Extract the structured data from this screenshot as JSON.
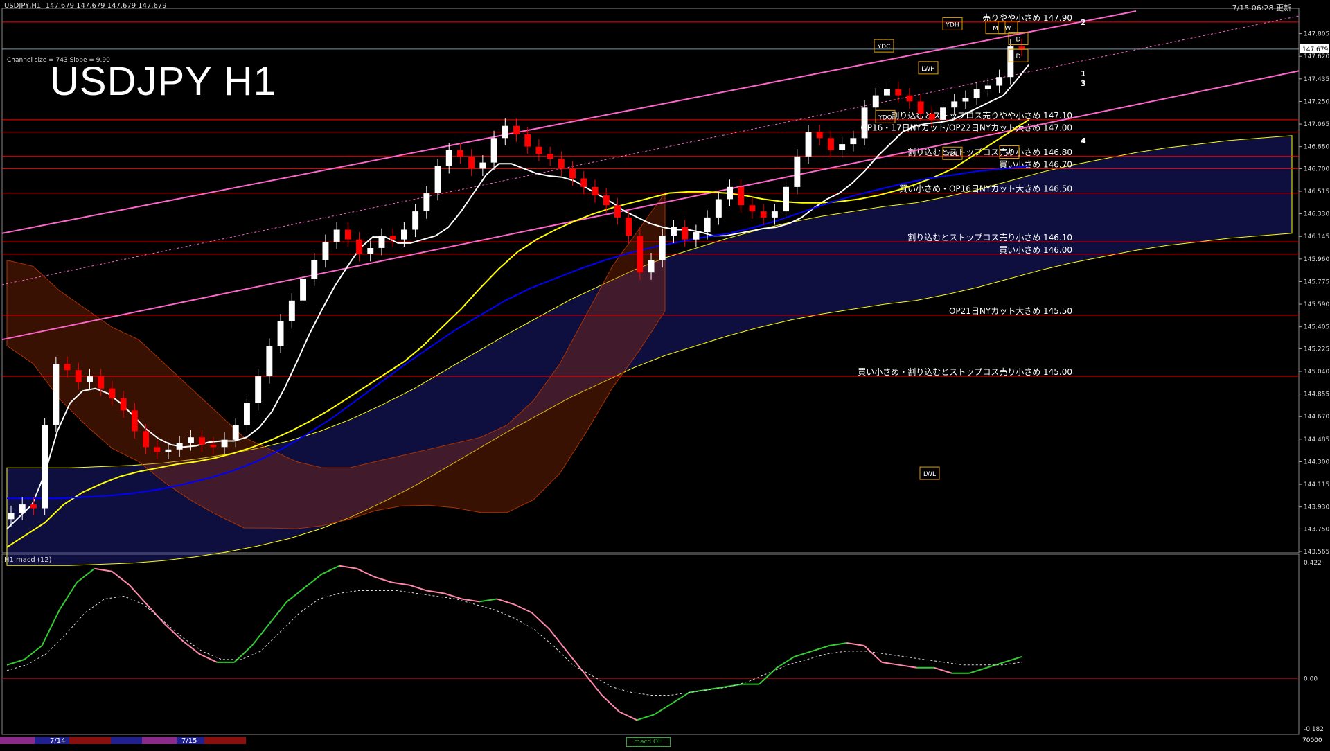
{
  "header": {
    "symbol_info": "USDJPY,H1  147.679 147.679 147.679 147.679",
    "timestamp": "7/15 06:28 更新",
    "big_title": "USDJPY H1",
    "channel_info": "Channel size = 743 Slope = 9.90"
  },
  "sub_window": {
    "title": "H1  macd (12)"
  },
  "time_axis": {
    "labels": [
      "7/14",
      "7/15"
    ],
    "macd_tag": "macd OH",
    "right_value": "70000"
  },
  "colors": {
    "background": "#000000",
    "bull": "#ffffff",
    "bear": "#ff0000",
    "ema_fast": "#ffffff",
    "ema_mid": "#ffff00",
    "ema_slow": "#0000ff",
    "channel": "#ff66cc",
    "level_line": "#ff0000",
    "cloud_bull": "#5555ff",
    "cloud_bear": "#ff5500",
    "macd_up": "#33cc33",
    "macd_down": "#ff88aa"
  },
  "chart_data": {
    "type": "line",
    "title": "USDJPY H1",
    "price_axis": {
      "ylim": [
        143.565,
        147.99
      ],
      "ticks": [
        "147.805",
        "147.620",
        "147.435",
        "147.250",
        "147.065",
        "146.880",
        "146.700",
        "146.515",
        "146.330",
        "146.145",
        "145.960",
        "145.775",
        "145.590",
        "145.405",
        "145.225",
        "145.040",
        "144.855",
        "144.670",
        "144.485",
        "144.300",
        "144.115",
        "143.930",
        "143.750",
        "143.565"
      ],
      "current_price": "147.679"
    },
    "macd_axis": {
      "ylim": [
        -0.182,
        0.422
      ],
      "ticks": [
        "0.422",
        "0.00",
        "-0.182"
      ]
    },
    "price_series": {
      "name": "USDJPY",
      "close": [
        143.88,
        143.95,
        143.92,
        144.6,
        145.1,
        145.05,
        144.95,
        145.0,
        144.9,
        144.82,
        144.72,
        144.55,
        144.42,
        144.38,
        144.4,
        144.45,
        144.5,
        144.44,
        144.42,
        144.48,
        144.6,
        144.78,
        145.0,
        145.25,
        145.45,
        145.62,
        145.8,
        145.95,
        146.1,
        146.2,
        146.12,
        146.0,
        146.05,
        146.15,
        146.12,
        146.2,
        146.35,
        146.5,
        146.72,
        146.85,
        146.8,
        146.7,
        146.75,
        146.95,
        147.05,
        146.98,
        146.88,
        146.82,
        146.78,
        146.7,
        146.62,
        146.55,
        146.48,
        146.4,
        146.3,
        146.15,
        145.85,
        145.95,
        146.15,
        146.22,
        146.12,
        146.18,
        146.3,
        146.45,
        146.55,
        146.4,
        146.35,
        146.3,
        146.35,
        146.55,
        146.8,
        147.0,
        146.95,
        146.85,
        146.9,
        146.95,
        147.2,
        147.3,
        147.35,
        147.3,
        147.25,
        147.15,
        147.1,
        147.2,
        147.25,
        147.28,
        147.35,
        147.38,
        147.45,
        147.7,
        147.68
      ]
    },
    "moving_averages": [
      {
        "name": "",
        "color": "#ffffff",
        "values": [
          143.75,
          143.85,
          143.95,
          144.2,
          144.55,
          144.78,
          144.88,
          144.9,
          144.86,
          144.78,
          144.68,
          144.57,
          144.49,
          144.44,
          144.42,
          144.43,
          144.46,
          144.47,
          144.47,
          144.5,
          144.58,
          144.71,
          144.9,
          145.12,
          145.35,
          145.55,
          145.74,
          145.9,
          146.05,
          146.14,
          146.14,
          146.09,
          146.09,
          146.12,
          146.15,
          146.22,
          146.35,
          146.5,
          146.65,
          146.74,
          146.74,
          146.7,
          146.66,
          146.64,
          146.63,
          146.6,
          146.54,
          146.48,
          146.42,
          146.35,
          146.3,
          146.25,
          146.22,
          146.2,
          146.2,
          146.18,
          146.15,
          146.15,
          146.17,
          146.19,
          146.21,
          146.22,
          146.25,
          146.3,
          146.38,
          146.45,
          146.5,
          146.58,
          146.68,
          146.8,
          146.9,
          147.0,
          147.05,
          147.07,
          147.08,
          147.1,
          147.15,
          147.2,
          147.25,
          147.3,
          147.42,
          147.55
        ]
      },
      {
        "name": "",
        "color": "#ffff00",
        "values": [
          143.6,
          143.7,
          143.8,
          143.95,
          144.05,
          144.12,
          144.18,
          144.22,
          144.25,
          144.28,
          144.3,
          144.33,
          144.37,
          144.42,
          144.48,
          144.55,
          144.63,
          144.72,
          144.82,
          144.92,
          145.02,
          145.12,
          145.25,
          145.4,
          145.55,
          145.72,
          145.88,
          146.02,
          146.12,
          146.2,
          146.27,
          146.33,
          146.38,
          146.42,
          146.46,
          146.5,
          146.51,
          146.51,
          146.5,
          146.48,
          146.45,
          146.43,
          146.42,
          146.42,
          146.43,
          146.45,
          146.48,
          146.52,
          146.57,
          146.63,
          146.7,
          146.8,
          146.9,
          147.0,
          147.1
        ]
      },
      {
        "name": "",
        "color": "#0000ff",
        "values": [
          144.0,
          144.0,
          144.0,
          144.01,
          144.02,
          144.04,
          144.07,
          144.11,
          144.16,
          144.22,
          144.3,
          144.4,
          144.52,
          144.65,
          144.8,
          144.95,
          145.1,
          145.24,
          145.38,
          145.5,
          145.62,
          145.72,
          145.8,
          145.88,
          145.95,
          146.01,
          146.06,
          146.1,
          146.14,
          146.17,
          146.22,
          146.28,
          146.35,
          146.42,
          146.48,
          146.53,
          146.58,
          146.62,
          146.65,
          146.68,
          146.7,
          146.72
        ]
      }
    ],
    "levels": [
      {
        "price": 147.9,
        "label": "売りやや小さめ 147.90"
      },
      {
        "price": 147.1,
        "label": "割り込むとストップロス売りやや小さめ 147.10"
      },
      {
        "price": 147.0,
        "label": "OP16・17日NYカット/OP22日NYカット大きめ 147.00"
      },
      {
        "price": 146.8,
        "label": "割り込むとストップロス売り小さめ 146.80"
      },
      {
        "price": 146.7,
        "label": "買い小さめ 146.70"
      },
      {
        "price": 146.5,
        "label": "買い小さめ・OP16日NYカット大きめ 146.50"
      },
      {
        "price": 146.1,
        "label": "割り込むとストップロス売り小さめ 146.10"
      },
      {
        "price": 146.0,
        "label": "買い小さめ 146.00"
      },
      {
        "price": 145.5,
        "label": "OP21日NYカット大きめ 145.50"
      },
      {
        "price": 145.0,
        "label": "買い小さめ・割り込むとストップロス売り小さめ 145.00"
      }
    ],
    "markers": [
      {
        "label": "YDH",
        "price": 147.88
      },
      {
        "label": "YDC",
        "price": 147.7
      },
      {
        "label": "LWH",
        "price": 147.52
      },
      {
        "label": "YDO",
        "price": 147.12
      },
      {
        "label": "YDL",
        "price": 146.82
      },
      {
        "label": "LWL",
        "price": 144.2
      },
      {
        "label": "M",
        "price": 147.85
      },
      {
        "label": "W",
        "price": 147.85
      },
      {
        "label": "D",
        "price": 147.76
      },
      {
        "label": "D",
        "price": 147.62
      },
      {
        "label": "W",
        "price": 146.83
      }
    ],
    "channel_labels": [
      "2",
      "1",
      "3",
      "4"
    ],
    "macd": {
      "main": [
        0.05,
        0.07,
        0.12,
        0.25,
        0.35,
        0.4,
        0.39,
        0.34,
        0.27,
        0.2,
        0.14,
        0.09,
        0.06,
        0.06,
        0.12,
        0.2,
        0.28,
        0.33,
        0.38,
        0.41,
        0.4,
        0.37,
        0.35,
        0.34,
        0.32,
        0.31,
        0.29,
        0.28,
        0.29,
        0.27,
        0.24,
        0.18,
        0.1,
        0.02,
        -0.06,
        -0.12,
        -0.15,
        -0.13,
        -0.09,
        -0.05,
        -0.04,
        -0.03,
        -0.02,
        -0.02,
        0.04,
        0.08,
        0.1,
        0.12,
        0.13,
        0.12,
        0.06,
        0.05,
        0.04,
        0.04,
        0.02,
        0.02,
        0.04,
        0.06,
        0.08
      ],
      "signal": [
        0.03,
        0.05,
        0.09,
        0.16,
        0.24,
        0.29,
        0.3,
        0.27,
        0.21,
        0.15,
        0.1,
        0.07,
        0.07,
        0.1,
        0.17,
        0.24,
        0.29,
        0.31,
        0.32,
        0.32,
        0.32,
        0.31,
        0.3,
        0.29,
        0.27,
        0.25,
        0.22,
        0.18,
        0.12,
        0.05,
        0.01,
        -0.03,
        -0.05,
        -0.06,
        -0.06,
        -0.05,
        -0.04,
        -0.03,
        -0.01,
        0.02,
        0.05,
        0.07,
        0.09,
        0.1,
        0.1,
        0.09,
        0.08,
        0.07,
        0.06,
        0.05,
        0.05,
        0.05,
        0.06
      ]
    }
  }
}
